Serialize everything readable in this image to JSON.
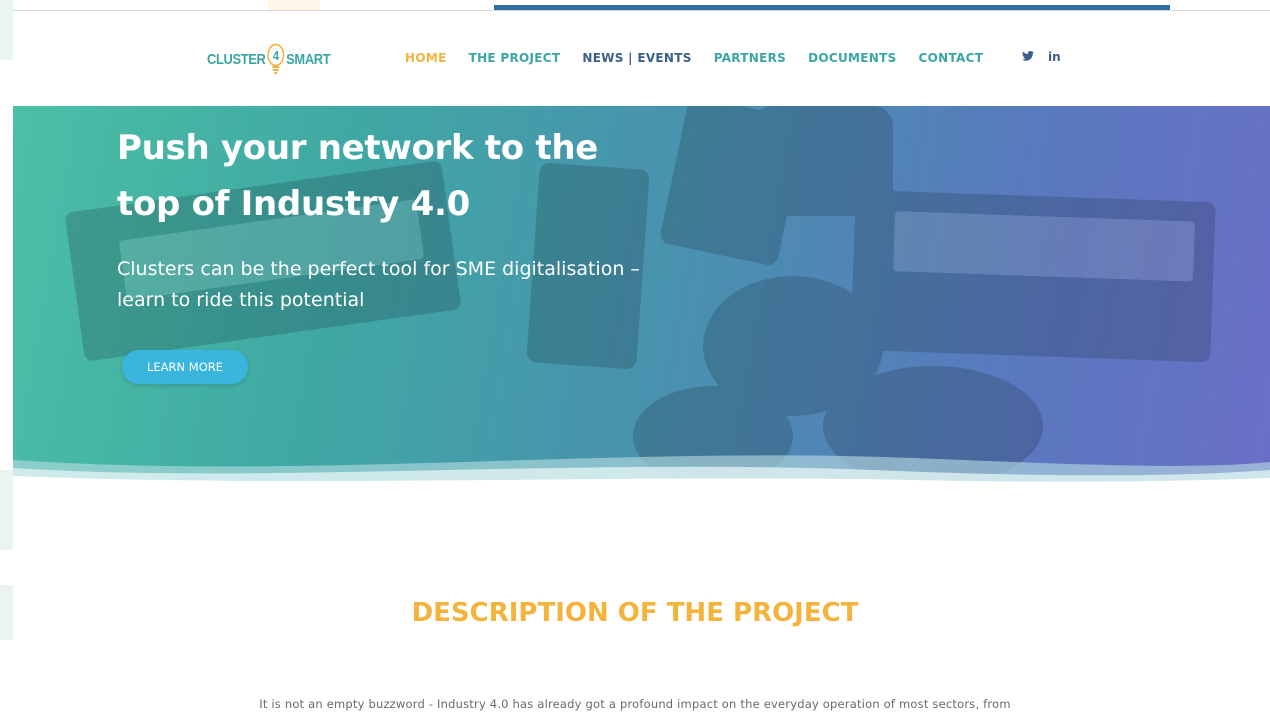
{
  "header": {
    "logo": {
      "left": "CLUSTER",
      "digit": "4",
      "right": "SMART"
    },
    "nav": [
      "HOME",
      "THE PROJECT",
      "NEWS | EVENTS",
      "PARTNERS",
      "DOCUMENTS",
      "CONTACT"
    ],
    "social": {
      "twitter": "twitter-icon",
      "linkedin": "in"
    }
  },
  "hero": {
    "title_line1": "Push your network to the",
    "title_line2": "top of Industry 4.0",
    "subtitle_line1": "Clusters can be the perfect tool for SME digitalisation –",
    "subtitle_line2": "learn to ride this potential",
    "cta": "LEARN MORE"
  },
  "description": {
    "title": "DESCRIPTION OF THE PROJECT",
    "intro": "It is not an empty buzzword - Industry 4.0 has already got a profound impact on the everyday operation of most sectors, from"
  },
  "colors": {
    "accent": "#f2b43c",
    "teal": "#3aa6a4",
    "navy": "#3a5f8a",
    "cta": "#3ab5de"
  }
}
